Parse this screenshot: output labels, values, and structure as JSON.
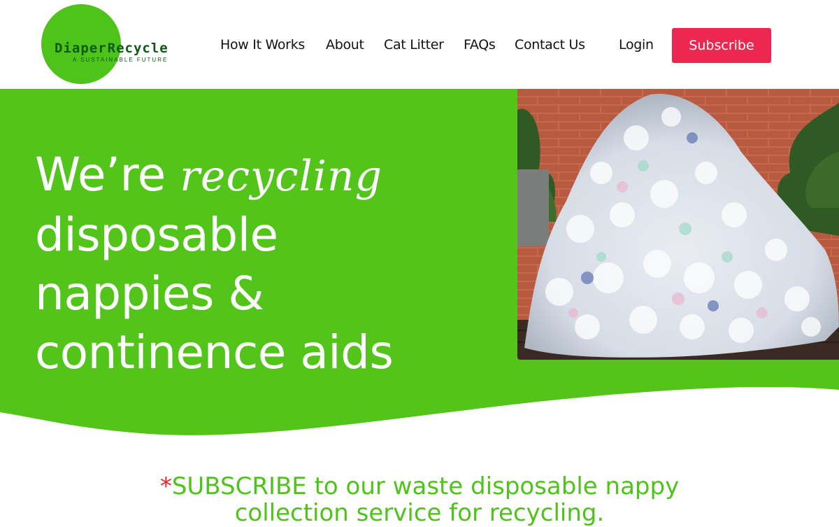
{
  "brand": {
    "name_part1": "Diaper",
    "name_part2": "Recycle",
    "tagline": "A SUSTAINABLE FUTURE",
    "logo_circle_color": "#4ec31a",
    "logo_text_color": "#0d5a14"
  },
  "nav": {
    "items": [
      "How It Works",
      "About",
      "Cat Litter",
      "FAQs",
      "Contact Us"
    ],
    "login": "Login",
    "subscribe": "Subscribe"
  },
  "hero": {
    "line1_prefix": "We’re ",
    "line1_script": "recycling",
    "line2": "disposable",
    "line3": "nappies &",
    "line4": "continence aids",
    "background_color": "#52c41a",
    "photo_icon": "diaper-pile-photo"
  },
  "cta": {
    "star": "*",
    "line1": "SUBSCRIBE to our waste disposable nappy",
    "line2": "collection service for recycling."
  },
  "colors": {
    "accent": "#ee2751",
    "green": "#4ec31a",
    "star": "#e5262d"
  }
}
